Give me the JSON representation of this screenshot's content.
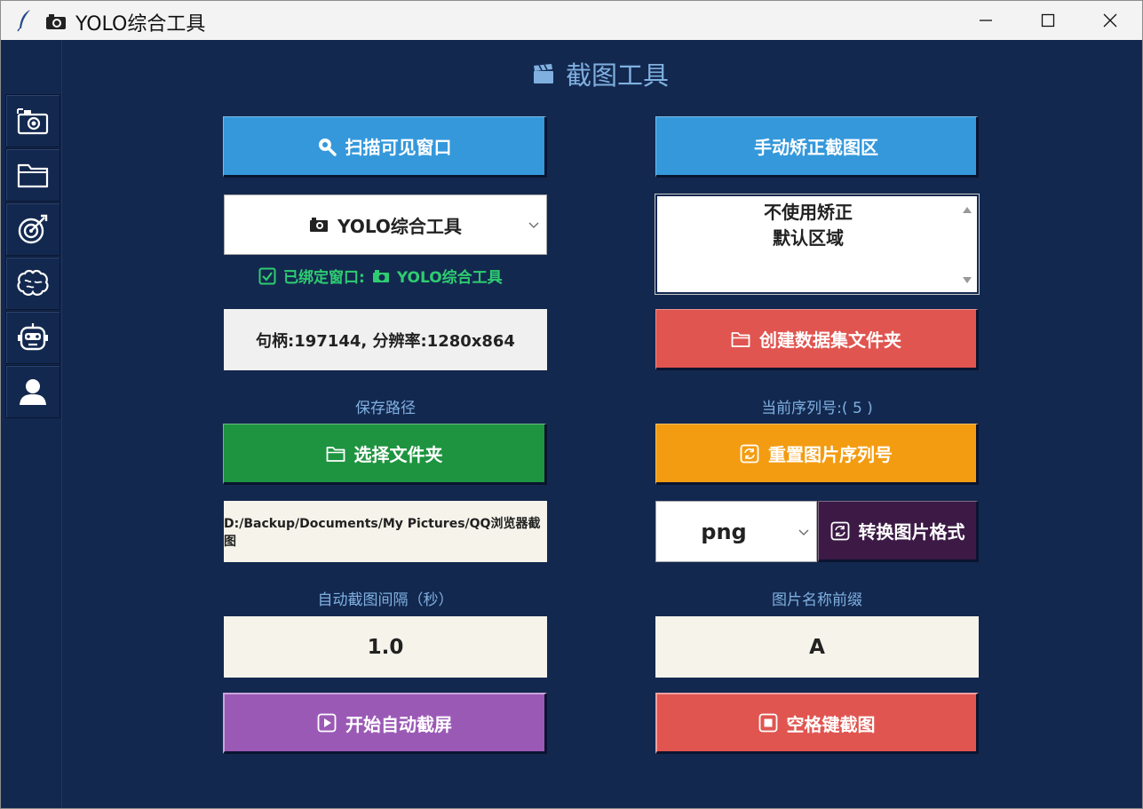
{
  "window": {
    "title": "YOLO综合工具",
    "controls": {
      "minimize": "—",
      "maximize": "☐",
      "close": "✕"
    }
  },
  "sidebar": {
    "items": [
      {
        "icon": "camera-screenshot-icon"
      },
      {
        "icon": "folder-icon"
      },
      {
        "icon": "target-icon"
      },
      {
        "icon": "brain-icon"
      },
      {
        "icon": "robot-icon"
      },
      {
        "icon": "user-icon"
      }
    ]
  },
  "page": {
    "title": "截图工具",
    "title_icon": "clapperboard-icon"
  },
  "left": {
    "scan_button": "扫描可见窗口",
    "window_select": "YOLO综合工具",
    "bound_status": "已绑定窗口:",
    "bound_window": "YOLO综合工具",
    "handle_info": "句柄:197144, 分辨率:1280x864",
    "save_path_label": "保存路径",
    "choose_folder_button": "选择文件夹",
    "save_path_value": "D:/Backup/Documents/My Pictures/QQ浏览器截图",
    "interval_label": "自动截图间隔（秒）",
    "interval_value": "1.0",
    "auto_capture_button": "开始自动截屏"
  },
  "right": {
    "manual_correct_button": "手动矫正截图区",
    "correction_list": [
      "不使用矫正",
      "默认区域"
    ],
    "create_dataset_button": "创建数据集文件夹",
    "serial_label": "当前序列号:( 5 )",
    "reset_serial_button": "重置图片序列号",
    "format_select": "png",
    "convert_format_button": "转换图片格式",
    "prefix_label": "图片名称前缀",
    "prefix_value": "A",
    "space_capture_button": "空格键截图"
  },
  "colors": {
    "background": "#13284f",
    "blue_button": "#3498db",
    "red_button": "#e05550",
    "green_button": "#1e9440",
    "orange_button": "#f39c12",
    "purple_button": "#9b59b6",
    "dark_purple_button": "#3c1a45",
    "bound_green": "#2ecc71",
    "label_blue": "#7fb0e0"
  }
}
